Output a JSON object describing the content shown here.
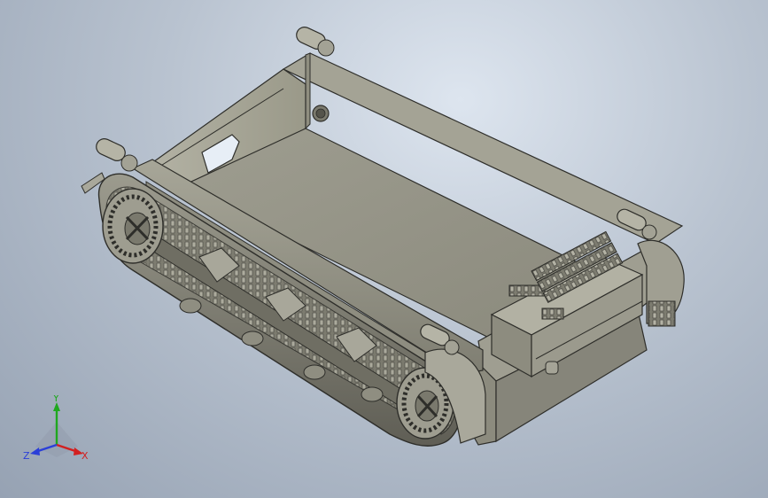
{
  "viewport": {
    "background_top": "#dde5ef",
    "background_bottom": "#96a2b3",
    "model_colors": {
      "face_light": "#a9a89a",
      "face_mid": "#8f8e80",
      "face_dark": "#6e6d62",
      "edge": "#2e2e2a"
    }
  },
  "triad": {
    "x_label": "X",
    "y_label": "Y",
    "z_label": "Z",
    "x_color": "#d22020",
    "y_color": "#1fa81f",
    "z_color": "#2b3fd8"
  }
}
